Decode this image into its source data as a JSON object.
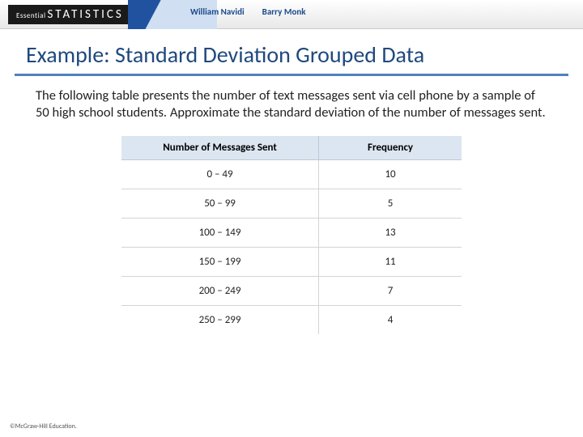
{
  "banner": {
    "brand_prefix": "Essential",
    "brand_main": "STATISTICS",
    "author1": "William Navidi",
    "author2": "Barry Monk"
  },
  "title": "Example: Standard Deviation Grouped Data",
  "description": "The following table presents the number of text messages sent via cell phone by a sample of 50 high school students. Approximate the standard deviation of the number of messages sent.",
  "table": {
    "headers": [
      "Number of Messages Sent",
      "Frequency"
    ],
    "rows": [
      {
        "range": "0 – 49",
        "freq": "10"
      },
      {
        "range": "50 – 99",
        "freq": "5"
      },
      {
        "range": "100 – 149",
        "freq": "13"
      },
      {
        "range": "150 – 199",
        "freq": "11"
      },
      {
        "range": "200 – 249",
        "freq": "7"
      },
      {
        "range": "250 – 299",
        "freq": "4"
      }
    ]
  },
  "footer": "©McGraw-Hill Education."
}
